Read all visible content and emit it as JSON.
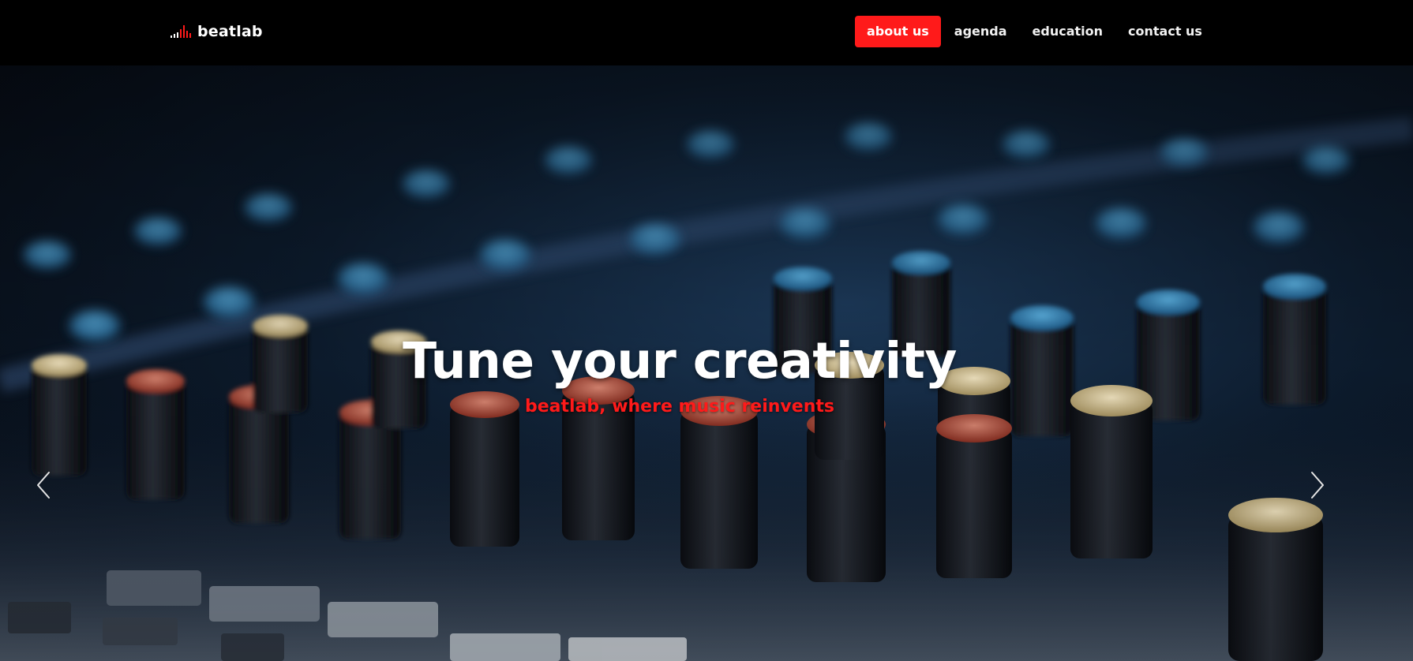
{
  "brand": {
    "name": "beatlab",
    "logo_icon": "equalizer-bars-icon",
    "accent_color": "#ff1a1a"
  },
  "nav": {
    "items": [
      {
        "label": "about us",
        "active": true
      },
      {
        "label": "agenda",
        "active": false
      },
      {
        "label": "education",
        "active": false
      },
      {
        "label": "contact us",
        "active": false
      }
    ]
  },
  "hero": {
    "title": "Tune your creativity",
    "subtitle": "beatlab, where music reinvents",
    "prev_icon": "chevron-left-icon",
    "next_icon": "chevron-right-icon"
  }
}
